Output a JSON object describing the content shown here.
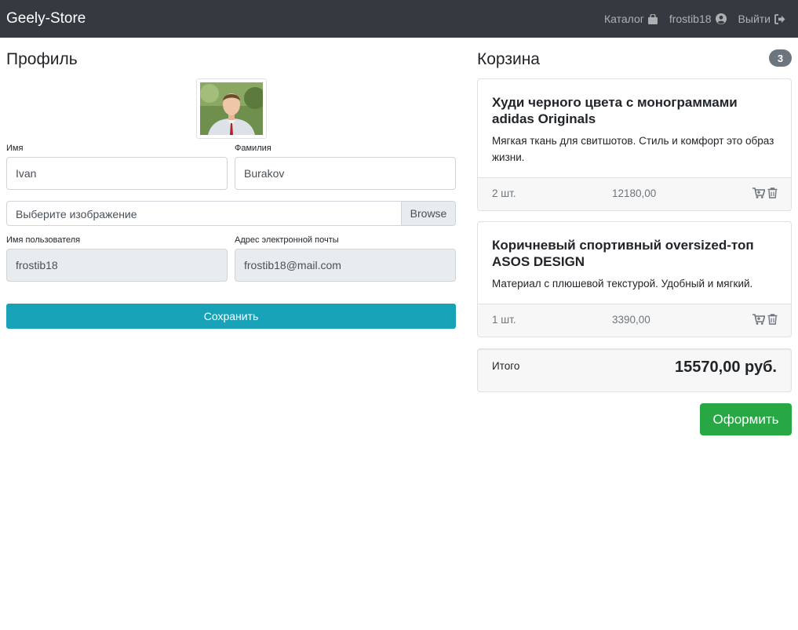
{
  "navbar": {
    "brand": "Geely-Store",
    "catalog": "Каталог",
    "username": "frostib18",
    "logout": "Выйти"
  },
  "profile": {
    "heading": "Профиль",
    "first_name_label": "Имя",
    "first_name_value": "Ivan",
    "last_name_label": "Фамилия",
    "last_name_value": "Burakov",
    "file_placeholder": "Выберите изображение",
    "file_button": "Browse",
    "username_label": "Имя пользователя",
    "username_value": "frostib18",
    "email_label": "Адрес электронной почты",
    "email_value": "frostib18@mail.com",
    "save_button": "Сохранить"
  },
  "cart": {
    "heading": "Корзина",
    "count": "3",
    "items": [
      {
        "title": "Худи черного цвета с монограммами adidas Originals",
        "description": "Мягкая ткань для свитшотов. Стиль и комфорт это образ жизни.",
        "quantity": "2 шт.",
        "price": "12180,00"
      },
      {
        "title": "Коричневый спортивный oversized-топ ASOS DESIGN",
        "description": "Материал с плюшевой текстурой. Удобный и мягкий.",
        "quantity": "1 шт.",
        "price": "3390,00"
      }
    ],
    "total_label": "Итого",
    "total_value": "15570,00 руб.",
    "checkout_button": "Оформить"
  },
  "icons": {
    "catalog": "shopping-bag-icon",
    "user": "user-circle-icon",
    "logout": "sign-out-icon",
    "cart_add": "cart-plus-icon",
    "delete": "trash-icon"
  },
  "colors": {
    "navbar": "#343a40",
    "save_button": "#17a2b8",
    "checkout_button": "#28a745",
    "badge": "#6c757d"
  }
}
